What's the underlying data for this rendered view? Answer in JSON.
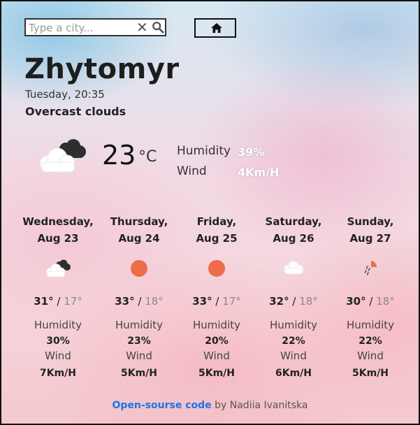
{
  "search": {
    "placeholder": "Type a city...",
    "value": ""
  },
  "current": {
    "city": "Zhytomyr",
    "datetime": "Tuesday, 20:35",
    "description": "Overcast clouds",
    "temperature": "23",
    "unit": "°C",
    "humidity_label": "Humidity",
    "humidity_value": "39%",
    "wind_label": "Wind",
    "wind_value": "4Km/H",
    "icon": "overcast-clouds-icon"
  },
  "forecast": [
    {
      "day": "Wednesday,",
      "date": "Aug 23",
      "icon": "overcast-clouds-icon",
      "max": "31°",
      "min": "17°",
      "humidity_label": "Humidity",
      "humidity": "30%",
      "wind_label": "Wind",
      "wind": "7Km/H"
    },
    {
      "day": "Thursday,",
      "date": "Aug 24",
      "icon": "sun-icon",
      "max": "33°",
      "min": "18°",
      "humidity_label": "Humidity",
      "humidity": "23%",
      "wind_label": "Wind",
      "wind": "5Km/H"
    },
    {
      "day": "Friday,",
      "date": "Aug 25",
      "icon": "sun-icon",
      "max": "33°",
      "min": "17°",
      "humidity_label": "Humidity",
      "humidity": "20%",
      "wind_label": "Wind",
      "wind": "5Km/H"
    },
    {
      "day": "Saturday,",
      "date": "Aug 26",
      "icon": "cloud-icon",
      "max": "32°",
      "min": "18°",
      "humidity_label": "Humidity",
      "humidity": "22%",
      "wind_label": "Wind",
      "wind": "6Km/H"
    },
    {
      "day": "Sunday,",
      "date": "Aug 27",
      "icon": "rain-sun-icon",
      "max": "30°",
      "min": "18°",
      "humidity_label": "Humidity",
      "humidity": "22%",
      "wind_label": "Wind",
      "wind": "5Km/H"
    }
  ],
  "separator": " / ",
  "footer": {
    "link_text": "Open-sourse code",
    "text": " by Nadiia Ivanitska"
  },
  "colors": {
    "accent": "#1a73e8",
    "sun": "#ef6c4a"
  }
}
